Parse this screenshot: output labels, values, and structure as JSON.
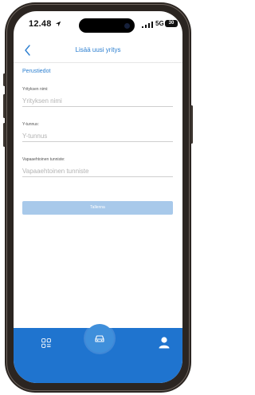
{
  "status_bar": {
    "time": "12.48",
    "network": "5G",
    "battery": "30"
  },
  "header": {
    "title": "Lisää uusi yritys",
    "back_icon": "chevron-left-icon"
  },
  "form": {
    "section_title": "Perustiedot",
    "fields": [
      {
        "label": "Yrityksen nimi:",
        "placeholder": "Yrityksen nimi",
        "value": ""
      },
      {
        "label": "Y-tunnus:",
        "placeholder": "Y-tunnus",
        "value": ""
      },
      {
        "label": "Vapaaehtoinen tunniste:",
        "placeholder": "Vapaaehtoinen tunniste",
        "value": ""
      }
    ],
    "save_label": "Tallenna"
  },
  "bottom_nav": {
    "items": [
      {
        "icon": "grid-icon"
      },
      {
        "icon": "car-icon"
      },
      {
        "icon": "person-icon"
      }
    ]
  },
  "colors": {
    "accent": "#2c7fd0",
    "nav_bg": "#1f74cf",
    "save_button_bg": "#a8c9ea"
  }
}
